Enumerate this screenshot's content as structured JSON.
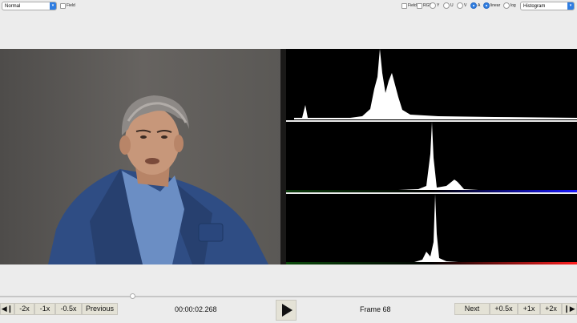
{
  "top_left": {
    "mode_select": "Normal",
    "field_label": "Field"
  },
  "top_right": {
    "field_label": "Field",
    "rgb_label": "RGB",
    "y_label": "Y",
    "u_label": "U",
    "v_label": "V",
    "a_label": "A",
    "linear_label": "linear",
    "log_label": "log",
    "view_select": "Histogram",
    "selected_channel": "A",
    "selected_scale": "linear"
  },
  "histograms": [
    {
      "channel": "luma",
      "peak_position": 0.32,
      "color": "#ffffff"
    },
    {
      "channel": "blue",
      "peak_position": 0.5,
      "color": "#1a1aff"
    },
    {
      "channel": "red",
      "peak_position": 0.52,
      "color": "#ff2020"
    }
  ],
  "timeline": {
    "position": 0.23
  },
  "controls": {
    "back_2x": "-2x",
    "back_1x": "-1x",
    "back_05x": "-0.5x",
    "previous": "Previous",
    "timecode": "00:00:02.268",
    "frame": "Frame 68",
    "next": "Next",
    "fwd_05x": "+0.5x",
    "fwd_1x": "+1x",
    "fwd_2x": "+2x"
  },
  "colors": {
    "accent": "#2f7de1",
    "button_bg": "#e4e2d6",
    "jacket": "#2f4d84"
  }
}
